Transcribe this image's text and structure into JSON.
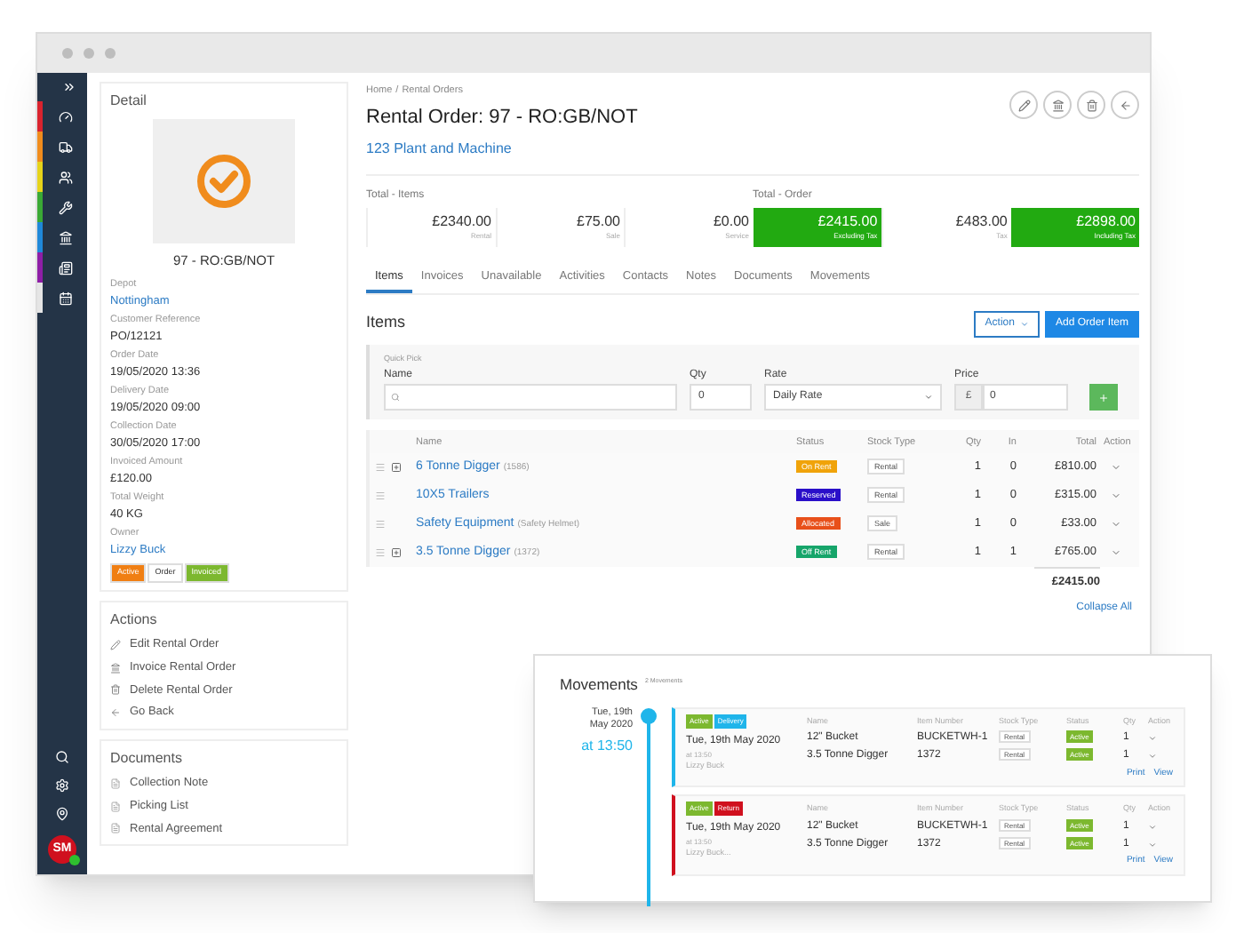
{
  "nav": {
    "items": [
      {
        "color": "#d9232e"
      },
      {
        "color": "#f08c1d"
      },
      {
        "color": "#e6d31a"
      },
      {
        "color": "#3aa935"
      },
      {
        "color": "#1f88d9"
      },
      {
        "color": "#8e1ea6"
      },
      {
        "color": "#e5e5e5"
      }
    ],
    "avatar": "SM"
  },
  "detail": {
    "title": "Detail",
    "reference": "97 - RO:GB/NOT",
    "fields": [
      {
        "label": "Depot",
        "value": "Nottingham",
        "kind": "link"
      },
      {
        "label": "Customer Reference",
        "value": "PO/12121",
        "kind": "text"
      },
      {
        "label": "Order Date",
        "value": "19/05/2020 13:36",
        "kind": "text"
      },
      {
        "label": "Delivery Date",
        "value": "19/05/2020 09:00",
        "kind": "text"
      },
      {
        "label": "Collection Date",
        "value": "30/05/2020 17:00",
        "kind": "text"
      },
      {
        "label": "Invoiced Amount",
        "value": "£120.00",
        "kind": "text"
      },
      {
        "label": "Total Weight",
        "value": "40 KG",
        "kind": "text"
      },
      {
        "label": "Owner",
        "value": "Lizzy Buck",
        "kind": "link"
      }
    ],
    "badges": [
      {
        "label": "Active",
        "color": "#f07f13"
      },
      {
        "label": "Order",
        "color": "#ffffff"
      },
      {
        "label": "Invoiced",
        "color": "#7cb82f"
      }
    ]
  },
  "actions": {
    "title": "Actions",
    "items": [
      "Edit Rental Order",
      "Invoice Rental Order",
      "Delete Rental Order",
      "Go Back"
    ]
  },
  "documents": {
    "title": "Documents",
    "items": [
      "Collection Note",
      "Picking List",
      "Rental Agreement"
    ]
  },
  "breadcrumb": [
    "Home",
    "/",
    "Rental Orders"
  ],
  "title": "Rental Order: 97 - RO:GB/NOT",
  "customer": "123 Plant and Machine",
  "totals": [
    {
      "label": "Total - Items",
      "cells": [
        {
          "value": "£2340.00",
          "caption": "Rental",
          "highlighted": false
        },
        {
          "value": "£75.00",
          "caption": "Sale",
          "highlighted": false
        },
        {
          "value": "£0.00",
          "caption": "Service",
          "highlighted": false
        }
      ]
    },
    {
      "label": "Total - Order",
      "cells": [
        {
          "value": "£2415.00",
          "caption": "Excluding Tax",
          "highlighted": true
        },
        {
          "value": "£483.00",
          "caption": "Tax",
          "highlighted": false
        },
        {
          "value": "£2898.00",
          "caption": "Including Tax",
          "highlighted": true
        }
      ]
    }
  ],
  "tabs": [
    {
      "label": "Items",
      "selected": true
    },
    {
      "label": "Invoices",
      "selected": false
    },
    {
      "label": "Unavailable",
      "selected": false
    },
    {
      "label": "Activities",
      "selected": false
    },
    {
      "label": "Contacts",
      "selected": false
    },
    {
      "label": "Notes",
      "selected": false
    },
    {
      "label": "Documents",
      "selected": false
    },
    {
      "label": "Movements",
      "selected": false
    }
  ],
  "items": {
    "title": "Items",
    "action_button": "Action",
    "add_button": "Add Order Item",
    "quick_pick": {
      "title": "Quick Pick",
      "name_label": "Name",
      "qty_label": "Qty",
      "qty_value": "0",
      "rate_label": "Rate",
      "rate_value": "Daily Rate",
      "price_label": "Price",
      "currency": "£",
      "price_value": "0"
    },
    "columns": [
      "Name",
      "Status",
      "Stock Type",
      "Qty",
      "In",
      "Total",
      "Action"
    ],
    "rows": [
      {
        "expandable": true,
        "name": "6 Tonne Digger",
        "detail": "(1586)",
        "status": "On Rent",
        "color": "#f0a30a",
        "stock_type": "Rental",
        "qty": "1",
        "in": "0",
        "total": "£810.00"
      },
      {
        "expandable": false,
        "name": "10X5 Trailers",
        "status": "Reserved",
        "color": "#2a0fc9",
        "stock_type": "Rental",
        "qty": "1",
        "in": "0",
        "total": "£315.00"
      },
      {
        "expandable": false,
        "name": "Safety Equipment",
        "detail": "(Safety Helmet)",
        "status": "Allocated",
        "color": "#e8501a",
        "stock_type": "Sale",
        "qty": "1",
        "in": "0",
        "total": "£33.00"
      },
      {
        "expandable": true,
        "name": "3.5 Tonne Digger",
        "detail": "(1372)",
        "status": "Off Rent",
        "color": "#16a56a",
        "stock_type": "Rental",
        "qty": "1",
        "in": "1",
        "total": "£765.00"
      }
    ],
    "grand_total": "£2415.00",
    "collapse": "Collapse All"
  },
  "movements": {
    "title": "Movements",
    "count": "2 Movements",
    "day": "Tue, 19th",
    "month": "May 2020",
    "time": "at 13:50",
    "cards": [
      {
        "color": "#1fb5ea",
        "columns": [
          "Name",
          "Item Number",
          "Stock Type",
          "Status",
          "Qty",
          "Action"
        ],
        "badges": [
          {
            "label": "Active",
            "color": "#7cb82f"
          },
          {
            "label": "Delivery",
            "color": "#1fb5ea"
          }
        ],
        "date": "Tue, 19th May 2020",
        "time": "at 13:50",
        "person": "Lizzy Buck",
        "rows": [
          {
            "name": "12\" Bucket",
            "number": "BUCKETWH-1",
            "stock_type": "Rental",
            "status": "Active",
            "qty": "1"
          },
          {
            "name": "3.5 Tonne Digger",
            "number": "1372",
            "stock_type": "Rental",
            "status": "Active",
            "qty": "1"
          }
        ],
        "links": [
          "Print",
          "View"
        ]
      },
      {
        "color": "#d0101e",
        "columns": [
          "Name",
          "Item Number",
          "Stock Type",
          "Status",
          "Qty",
          "Action"
        ],
        "badges": [
          {
            "label": "Active",
            "color": "#7cb82f"
          },
          {
            "label": "Return",
            "color": "#d0101e"
          }
        ],
        "date": "Tue, 19th May 2020",
        "time": "at 13:50",
        "person": "Lizzy Buck...",
        "rows": [
          {
            "name": "12\" Bucket",
            "number": "BUCKETWH-1",
            "stock_type": "Rental",
            "status": "Active",
            "qty": "1"
          },
          {
            "name": "3.5 Tonne Digger",
            "number": "1372",
            "stock_type": "Rental",
            "status": "Active",
            "qty": "1"
          }
        ],
        "links": [
          "Print",
          "View"
        ]
      }
    ]
  }
}
